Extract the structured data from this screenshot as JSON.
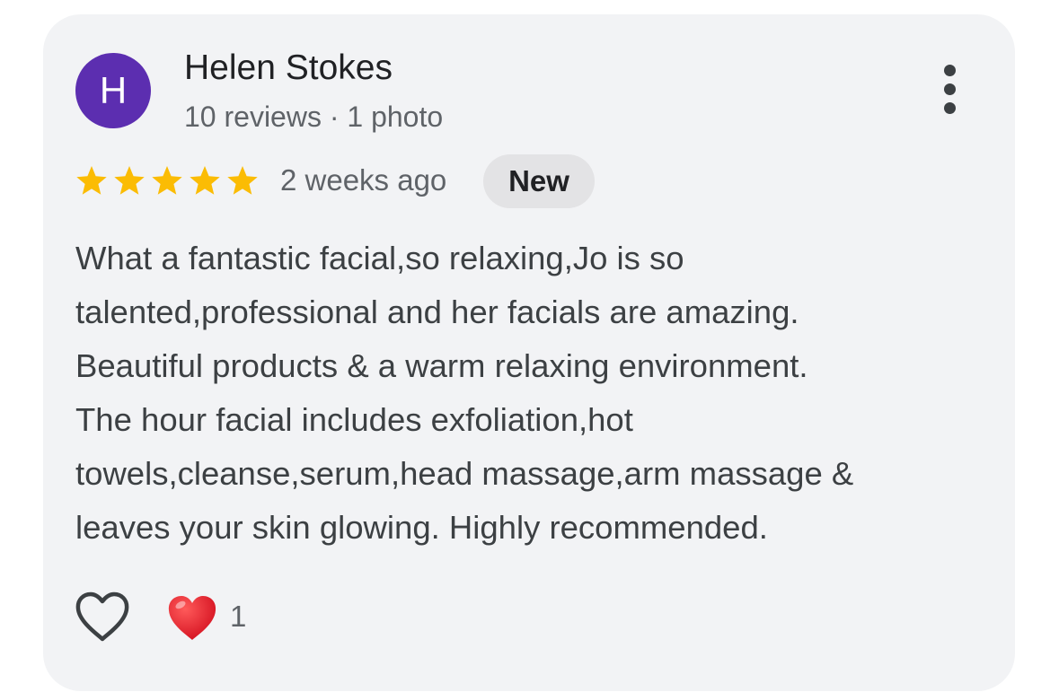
{
  "reviewer": {
    "initial": "H",
    "avatar_color": "#5c2eb0",
    "name": "Helen Stokes",
    "meta": "10 reviews · 1 photo"
  },
  "rating": {
    "stars": 5,
    "max_stars": 5,
    "star_color": "#fbbc04",
    "time": "2 weeks ago",
    "badge": "New"
  },
  "review": {
    "lines": [
      "What a fantastic facial,so relaxing,Jo is so",
      "talented,professional and her facials are amazing.",
      "Beautiful products & a warm relaxing environment.",
      "The hour facial includes exfoliation,hot",
      "towels,cleanse,serum,head massage,arm massage &",
      "leaves your skin glowing. Highly recommended."
    ]
  },
  "actions": {
    "like_icon": "heart-outline-icon",
    "reaction_icon": "red-heart-icon",
    "reaction_count": "1"
  },
  "icons": {
    "more": "more-vert-icon"
  }
}
